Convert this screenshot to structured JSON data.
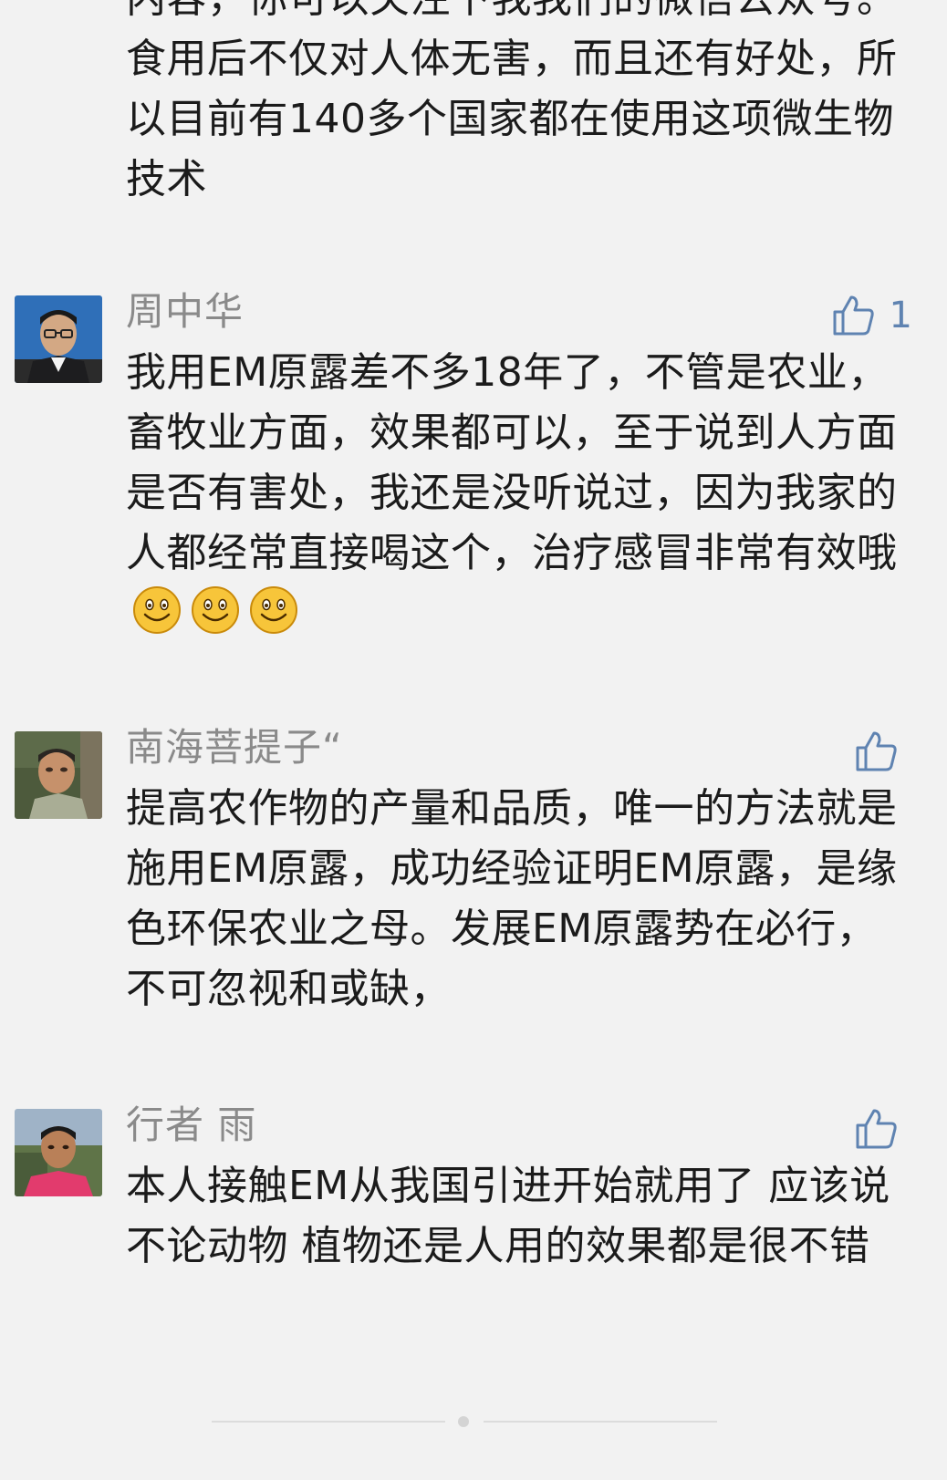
{
  "top_reply_text": "内容，你可以关注下我我们的微信公众号。食用后不仅对人体无害，而且还有好处，所以目前有140多个国家都在使用这项微生物技术",
  "comments": [
    {
      "name": "周中华",
      "likes": "1",
      "text": "我用EM原露差不多18年了，不管是农业，畜牧业方面，效果都可以，至于说到人方面是否有害处，我还是没听说过，因为我家的人都经常直接喝这个，治疗感冒非常有效哦",
      "emojis": [
        "smiley-emoji-icon",
        "smiley-emoji-icon",
        "smiley-emoji-icon"
      ]
    },
    {
      "name": "南海菩提子“",
      "likes": "",
      "text": "提高农作物的产量和品质，唯一的方法就是施用EM原露，成功经验证明EM原露，是缘色环保农业之母。发展EM原露势在必行，不可忽视和或缺，"
    },
    {
      "name": "行者 雨",
      "likes": "",
      "text": "本人接触EM从我国引进开始就用了 应该说不论动物 植物还是人用的效果都是很不错"
    }
  ],
  "colors": {
    "background": "#f2f2f2",
    "name": "#8a8a8a",
    "text": "#1b1b1b",
    "like_accent": "#5f83b1",
    "divider": "#dcdcdc"
  },
  "icons": [
    "thumbs-up-icon",
    "smiley-emoji-icon"
  ]
}
